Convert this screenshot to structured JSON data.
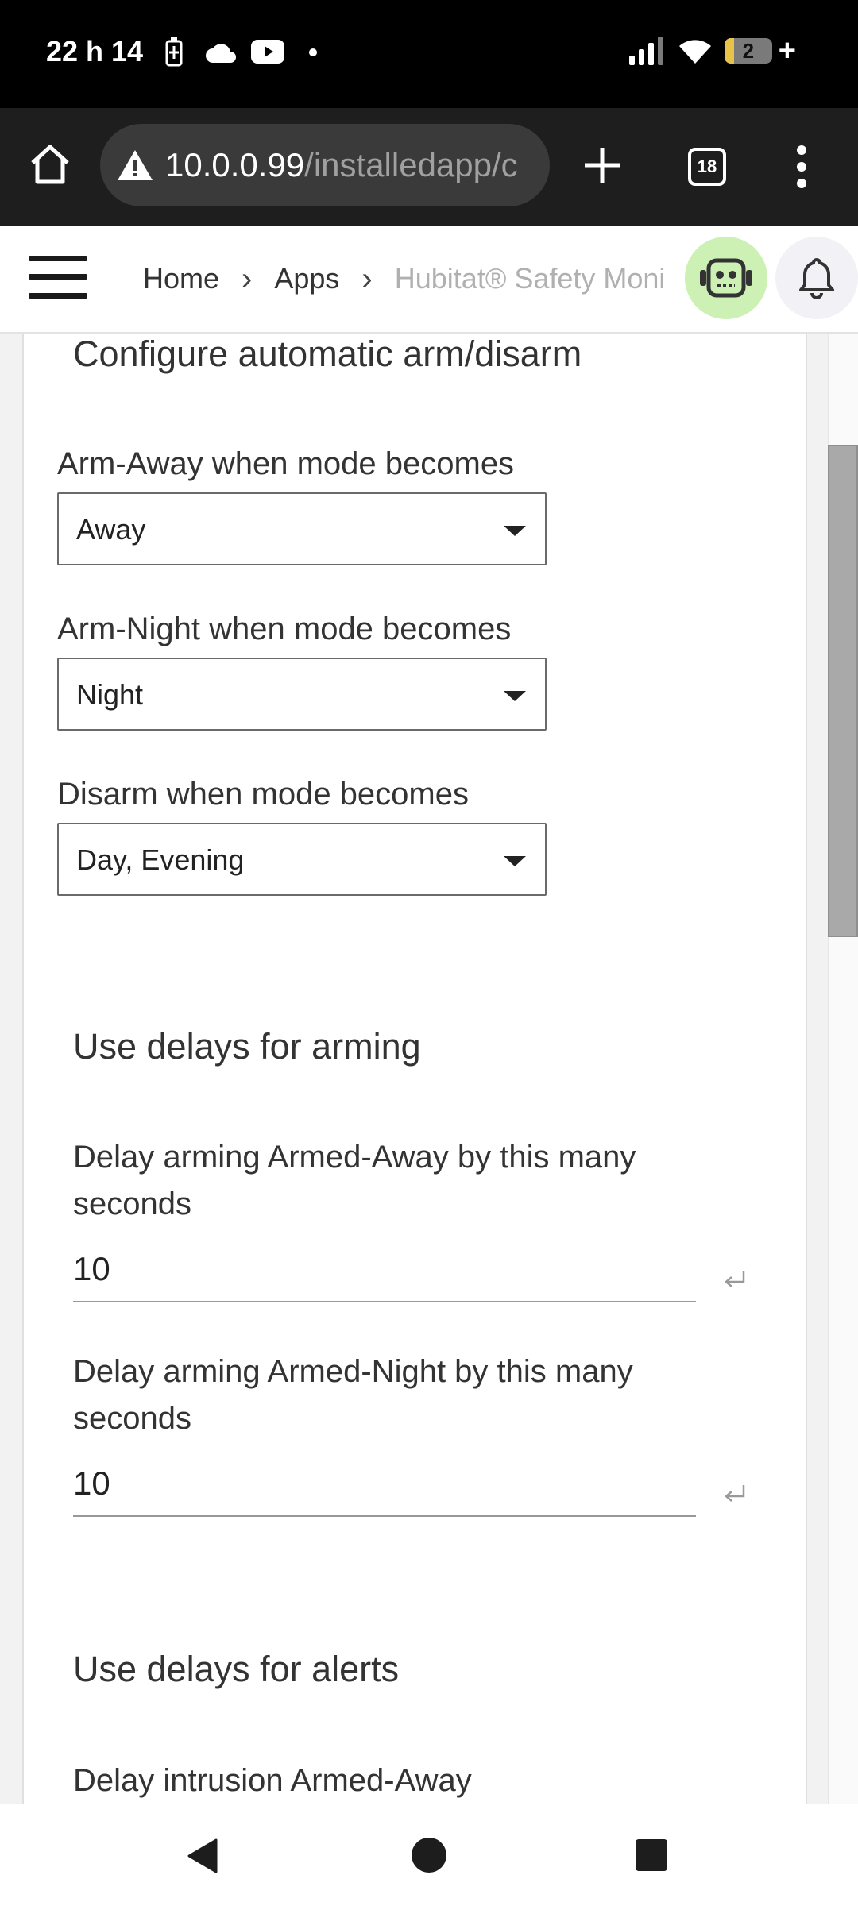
{
  "status_bar": {
    "time": "22 h 14",
    "battery_level": "2",
    "icons": [
      "battery-saver-icon",
      "cloud-icon",
      "youtube-icon",
      "notification-dot-icon",
      "signal-icon",
      "wifi-icon",
      "battery-icon"
    ]
  },
  "browser": {
    "url_host": "10.0.0.99",
    "url_path": "/installedapp/c",
    "tab_count": "18"
  },
  "header": {
    "breadcrumb": [
      "Home",
      "Apps",
      "Hubitat® Safety Moni"
    ]
  },
  "sections": {
    "auto_arm": {
      "title": "Configure automatic arm/disarm",
      "arm_away_label": "Arm-Away when mode becomes",
      "arm_away_value": "Away",
      "arm_night_label": "Arm-Night when mode becomes",
      "arm_night_value": "Night",
      "disarm_label": "Disarm when mode becomes",
      "disarm_value": "Day, Evening"
    },
    "arming_delays": {
      "title": "Use delays for arming",
      "away_label": "Delay arming Armed-Away by this many seconds",
      "away_value": "10",
      "night_label": "Delay arming Armed-Night by this many seconds",
      "night_value": "10"
    },
    "alert_delays": {
      "title": "Use delays for alerts",
      "intrusion_away_label": "Delay intrusion Armed-Away"
    }
  },
  "colors": {
    "robot_button_bg": "#cdf0b5",
    "scroll_thumb": "#a9a9a9"
  }
}
